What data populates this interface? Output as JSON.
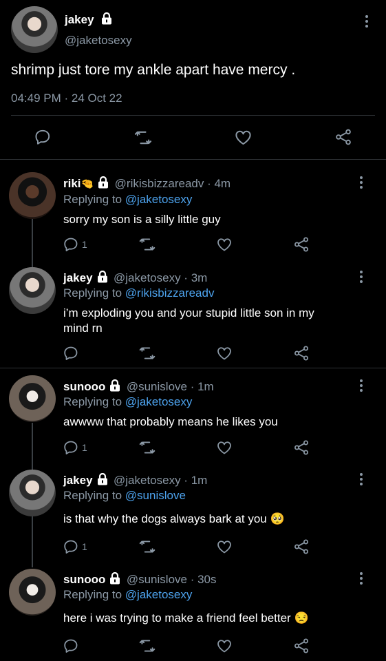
{
  "main_tweet": {
    "name": "jakey",
    "handle": "@jaketosexy",
    "text": "shrimp just tore my ankle apart have mercy .",
    "timestamp": "04:49 PM · 24 Oct 22"
  },
  "replies": [
    {
      "name": "riki",
      "handle": "@rikisbizzareadv",
      "time": "4m",
      "reply_prefix": "Replying to ",
      "reply_target": "@jaketosexy",
      "text": "sorry my son is a silly little guy",
      "reply_count": "1"
    },
    {
      "name": "jakey",
      "handle": "@jaketosexy",
      "time": "3m",
      "reply_prefix": "Replying to ",
      "reply_target": "@rikisbizzareadv",
      "text_line1": "i’m exploding you and your stupid little son in my",
      "text_line2": "mind rn"
    },
    {
      "name": "sunooo",
      "handle": "@sunislove",
      "time": "1m",
      "reply_prefix": "Replying to ",
      "reply_target": "@jaketosexy",
      "text": "awwww that probably means he likes you",
      "reply_count": "1"
    },
    {
      "name": "jakey",
      "handle": "@jaketosexy",
      "time": "1m",
      "reply_prefix": "Replying to ",
      "reply_target": "@sunislove",
      "text": "is that why the dogs always bark at you 🥺",
      "reply_count": "1"
    },
    {
      "name": "sunooo",
      "handle": "@sunislove",
      "time": "30s",
      "reply_prefix": "Replying to ",
      "reply_target": "@jaketosexy",
      "text": "here i was trying to make a friend feel better 😒"
    }
  ],
  "separator": " · ",
  "colors": {
    "background": "#000000",
    "muted": "#8b98a5",
    "link": "#4da3ee",
    "divider": "#2f3336"
  },
  "icons": [
    "lock-icon",
    "more-icon",
    "reply-icon",
    "retweet-icon",
    "like-icon",
    "share-icon"
  ]
}
